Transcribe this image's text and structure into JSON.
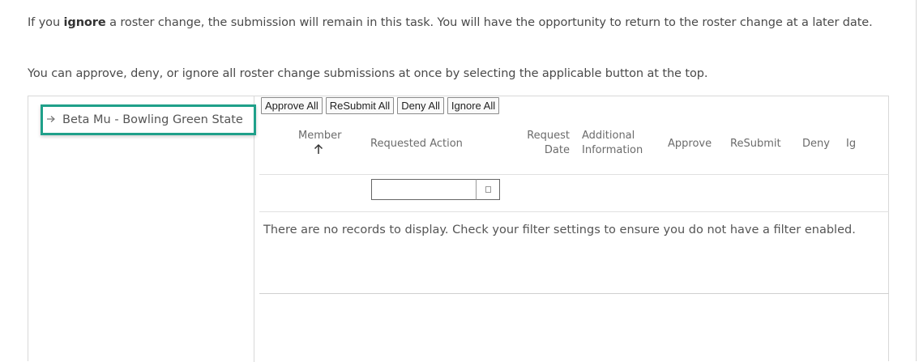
{
  "instructions": {
    "p1_prefix": "If you ",
    "p1_bold": "ignore",
    "p1_suffix": " a roster change, the submission will remain in this task. You will have the opportunity to return to the roster change at a later date.",
    "p2": "You can approve, deny, or ignore all roster change submissions at once by selecting the applicable button at the top."
  },
  "tree": {
    "items": [
      {
        "label": "Beta Mu - Bowling Green State",
        "expand_icon": "chevron-right-icon"
      }
    ],
    "highlight_color": "#1fa08a"
  },
  "toolbar": {
    "approve_all": "Approve All",
    "resubmit_all": "ReSubmit All",
    "deny_all": "Deny All",
    "ignore_all": "Ignore All"
  },
  "table": {
    "columns": {
      "member": "Member",
      "member_sort_icon": "arrow-up-icon",
      "requested_action": "Requested Action",
      "request_date_line1": "Request",
      "request_date_line2": "Date",
      "additional_info_line1": "Additional",
      "additional_info_line2": "Information",
      "approve": "Approve",
      "resubmit": "ReSubmit",
      "deny": "Deny",
      "ignore": "Ig"
    },
    "filter": {
      "value": ""
    },
    "empty_message": "There are no records to display. Check your filter settings to ensure you do not have a filter enabled."
  }
}
